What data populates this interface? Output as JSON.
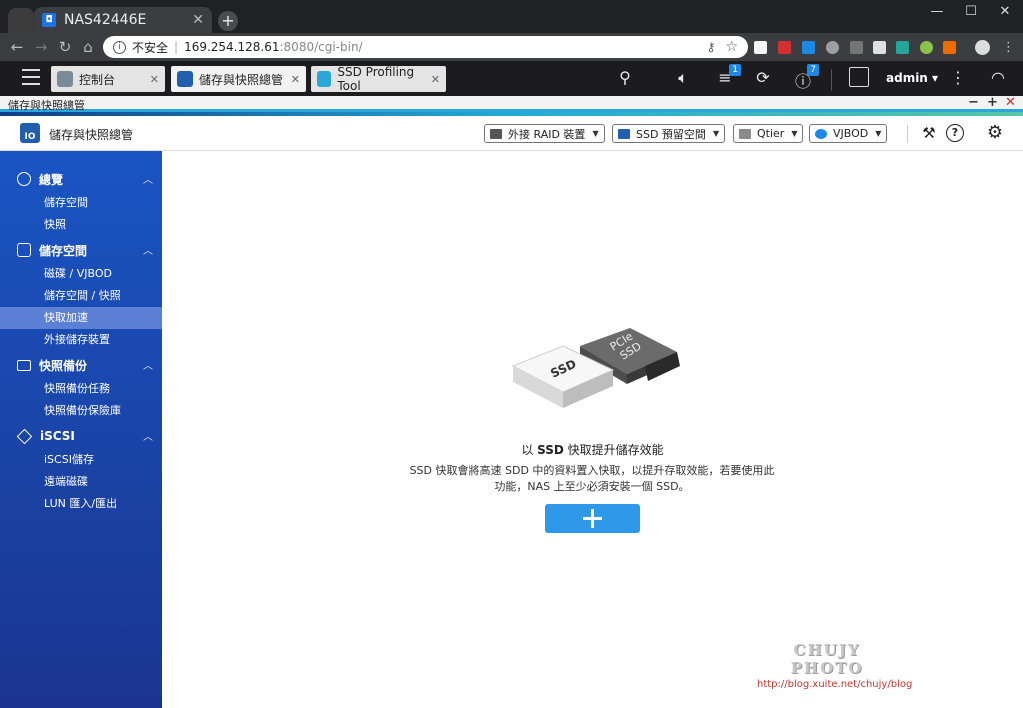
{
  "browser": {
    "tab_title": "NAS42446E",
    "tab_favicon": "qnap-icon",
    "address": {
      "security": "不安全",
      "host": "169.254.128.61",
      "path": ":8080/cgi-bin/"
    },
    "window_controls": [
      "—",
      "☐",
      "✕"
    ]
  },
  "qts": {
    "tabs": [
      {
        "label": "控制台",
        "icon": "control-panel-icon",
        "active": false
      },
      {
        "label": "儲存與快照總管",
        "icon": "storage-icon",
        "active": true
      },
      {
        "label": "SSD Profiling Tool",
        "icon": "ssd-profiling-icon",
        "active": false
      }
    ],
    "notification_badge": "1",
    "info_badge": "7",
    "user": "admin"
  },
  "app_window": {
    "title": "儲存與快照總管"
  },
  "header": {
    "app_name": "儲存與快照總管",
    "buttons": [
      {
        "label": "外接 RAID 裝置",
        "icon": "external-raid-icon"
      },
      {
        "label": "SSD 預留空間",
        "icon": "ssd-overprovision-icon"
      },
      {
        "label": "Qtier",
        "icon": "qtier-icon"
      },
      {
        "label": "VJBOD",
        "icon": "vjbod-icon"
      }
    ]
  },
  "sidebar": {
    "sections": [
      {
        "label": "總覽",
        "icon": "dashboard-icon",
        "items": [
          "儲存空間",
          "快照"
        ]
      },
      {
        "label": "儲存空間",
        "icon": "storage-stack-icon",
        "items": [
          "磁碟 / VJBOD",
          "儲存空間 / 快照",
          "快取加速",
          "外接儲存裝置"
        ]
      },
      {
        "label": "快照備份",
        "icon": "snapshot-backup-icon",
        "items": [
          "快照備份任務",
          "快照備份保險庫"
        ]
      },
      {
        "label": "iSCSI",
        "icon": "iscsi-icon",
        "items": [
          "iSCSI儲存",
          "遠端磁碟",
          "LUN 匯入/匯出"
        ]
      }
    ],
    "active_item": "快取加速"
  },
  "main": {
    "illustration_labels": {
      "ssd": "SSD",
      "pcie": "PCIe",
      "pcie_ssd": "SSD"
    },
    "title_prefix": "以 ",
    "title_bold": "SSD",
    "title_suffix": " 快取提升儲存效能",
    "description": "SSD 快取會將高速 SDD 中的資料置入快取，以提升存取效能，若要使用此功能，NAS 上至少必須安裝一個 SSD。"
  },
  "watermark": {
    "title": "CHUJY PHOTO",
    "url": "http://blog.xuite.net/chujy/blog"
  }
}
